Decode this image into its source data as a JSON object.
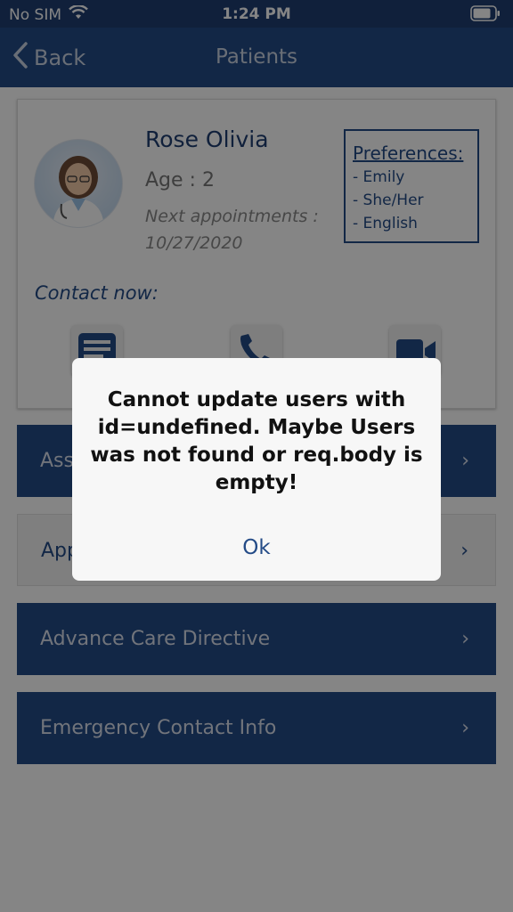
{
  "status_bar": {
    "carrier": "No SIM",
    "time": "1:24 PM"
  },
  "nav": {
    "back_label": "Back",
    "title": "Patients"
  },
  "patient": {
    "name": "Rose Olivia",
    "age": "Age : 2",
    "next_label": "Next appointments :",
    "next_date": "10/27/2020",
    "preferences": {
      "title": "Preferences:",
      "items": [
        "- Emily",
        "- She/Her",
        "- English"
      ]
    },
    "contact_label": "Contact now:",
    "contact_icons": [
      "message-icon",
      "phone-icon",
      "video-icon"
    ]
  },
  "menu": {
    "items": [
      {
        "label": "Assessments"
      },
      {
        "label": "Appointments"
      },
      {
        "label": "Advance Care Directive"
      },
      {
        "label": "Emergency Contact Info"
      }
    ],
    "chevron": "›"
  },
  "alert": {
    "message": "Cannot update users with id=undefined. Maybe Users was not found or req.body is empty!",
    "ok_label": "Ok"
  },
  "colors": {
    "primary": "#244b87",
    "status_bar": "#1f3f72"
  }
}
